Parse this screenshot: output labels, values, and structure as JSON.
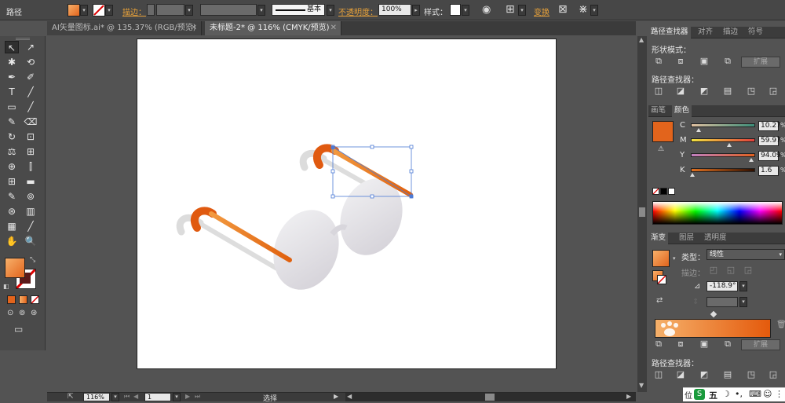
{
  "control_bar": {
    "object_label": "路径",
    "stroke_label": "描边：",
    "stroke_style": "基本",
    "opacity_label": "不透明度：",
    "opacity_value": "100%",
    "style_label": "样式：",
    "transform_label": "变换"
  },
  "doc_tabs": [
    {
      "label": "AI矢量图标.ai* @ 135.37% (RGB/预览)",
      "close": "✕"
    },
    {
      "label": "未标题-2* @ 116% (CMYK/预览)",
      "close": "✕"
    }
  ],
  "tools": [
    "↖",
    "↗",
    "✱",
    "⟲",
    "✒",
    "✐",
    "T",
    "╱",
    "▭",
    "╱",
    "✎",
    "⌫",
    "↻",
    "⊡",
    "⚖",
    "⊞",
    "⊕",
    "⫿",
    "⊞",
    "▬",
    "✎",
    "⊚",
    "⊛",
    "▥",
    "▦",
    "╱",
    "✋",
    "🔍"
  ],
  "status_bar": {
    "zoom": "116%",
    "page": "1",
    "mode": "选择"
  },
  "pathfinder": {
    "tabs": [
      "路径查找器",
      "对齐",
      "描边",
      "符号"
    ],
    "shape_modes": "形状模式：",
    "pathfinders": "路径查找器：",
    "expand": "扩展"
  },
  "color": {
    "tabs": [
      "画笔",
      "颜色"
    ],
    "channels": [
      {
        "name": "C",
        "value": "10.27",
        "percent": 0.12,
        "grad": "linear-gradient(90deg,#e0c0a0,#3c8c78)"
      },
      {
        "name": "M",
        "value": "59.97",
        "percent": 0.6,
        "grad": "linear-gradient(90deg,#f0e040,#e0403c)"
      },
      {
        "name": "Y",
        "value": "94.09",
        "percent": 0.94,
        "grad": "linear-gradient(90deg,#c080c0,#e06020)"
      },
      {
        "name": "K",
        "value": "1.6",
        "percent": 0.02,
        "grad": "linear-gradient(90deg,#e07020,#301000)"
      }
    ],
    "fill_color": "#e2641c",
    "unit": "%"
  },
  "gradient": {
    "tabs": [
      "渐变",
      "图层",
      "透明度"
    ],
    "type_label": "类型：",
    "type_value": "线性",
    "stroke_label": "描边：",
    "angle_value": "-118.9°",
    "expand": "扩展",
    "pathfinders": "路径查找器：",
    "bar_colors": [
      "#f5b06a",
      "#e45a0c"
    ]
  },
  "ime": {
    "label": "五",
    "prefix": "位"
  },
  "colors": {
    "orange": "#e2641c",
    "orange_light": "#f2a55a",
    "accent_label": "#e8a23a"
  }
}
